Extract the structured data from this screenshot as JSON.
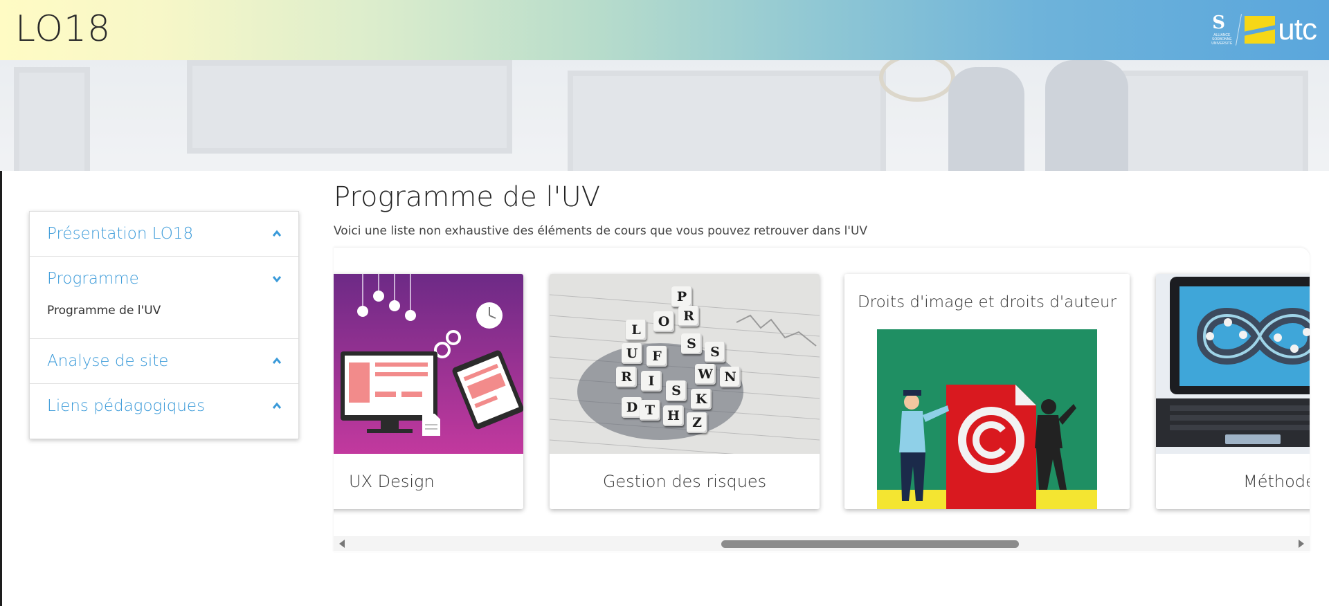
{
  "site": {
    "title": "LO18"
  },
  "logos": {
    "sorbonne_letter": "S",
    "sorbonne_text": "ALLIANCE SORBONNE UNIVERSITÉ",
    "utc_text": "utc"
  },
  "sidebar": {
    "sections": [
      {
        "label": "Présentation LO18",
        "icon": "chevron-up-icon",
        "expanded": false
      },
      {
        "label": "Programme",
        "icon": "chevron-down-icon",
        "expanded": true,
        "items": [
          {
            "label": "Programme de l'UV"
          }
        ]
      },
      {
        "label": "Analyse de site",
        "icon": "chevron-up-icon",
        "expanded": false
      },
      {
        "label": "Liens pédagogiques",
        "icon": "chevron-up-icon",
        "expanded": false
      }
    ]
  },
  "main": {
    "title": "Programme de l'UV",
    "subtitle": "Voici une liste non exhaustive des éléments de cours que vous pouvez retrouver dans l'UV",
    "cards": [
      {
        "caption": "UX Design"
      },
      {
        "caption": "Gestion des risques",
        "tiles": [
          "P",
          "R",
          "O",
          "L",
          "S",
          "S",
          "U",
          "F",
          "W",
          "N",
          "R",
          "I",
          "S",
          "K",
          "D",
          "T",
          "H",
          "Z"
        ]
      },
      {
        "caption": "Droits d'image et droits d'auteur"
      },
      {
        "caption": "Méthode"
      }
    ]
  },
  "colors": {
    "accent": "#3a9ad9",
    "header_start": "#fffbc4",
    "header_end": "#5aa6dc"
  }
}
